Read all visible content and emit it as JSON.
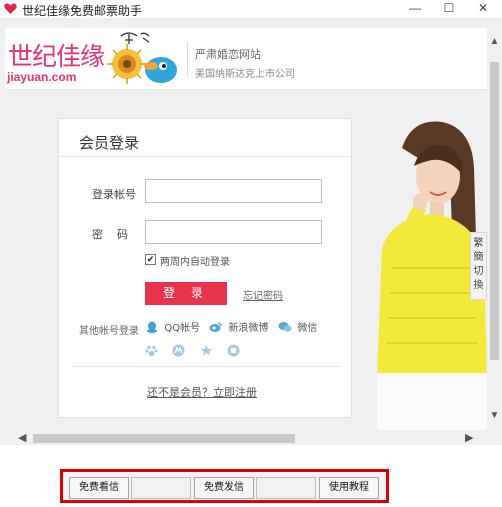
{
  "window": {
    "title": "世纪佳缘免费邮票助手",
    "minimize": "—",
    "maximize": "☐",
    "close": "✕"
  },
  "header": {
    "logo_cn": "世纪佳缘",
    "logo_en": "jiayuan.com",
    "slogan_main": "严肃婚恋网站",
    "slogan_sub": "美国纳斯达克上市公司"
  },
  "login": {
    "title": "会员登录",
    "account_label": "登录帐号",
    "password_label": "密码",
    "account_value": "",
    "password_value": "",
    "remember_label": "两周内自动登录",
    "remember_checked": "✔",
    "login_button": "登 录",
    "forgot_link": "忘记密码",
    "other_label": "其他帐号登录",
    "social": [
      {
        "label": "QQ帐号",
        "icon": "qq-icon"
      },
      {
        "label": "新浪微博",
        "icon": "weibo-icon"
      },
      {
        "label": "微信",
        "icon": "wechat-icon"
      }
    ],
    "register_link": "还不是会员？立即注册"
  },
  "side": {
    "lang_switch": "繁簡切換"
  },
  "toolbar": {
    "free_read": "免费看信",
    "free_send": "免费发信",
    "tutorial": "使用教程"
  },
  "colors": {
    "brand": "#e8336e",
    "login_button": "#e8334d",
    "highlight_border": "#e00000"
  }
}
